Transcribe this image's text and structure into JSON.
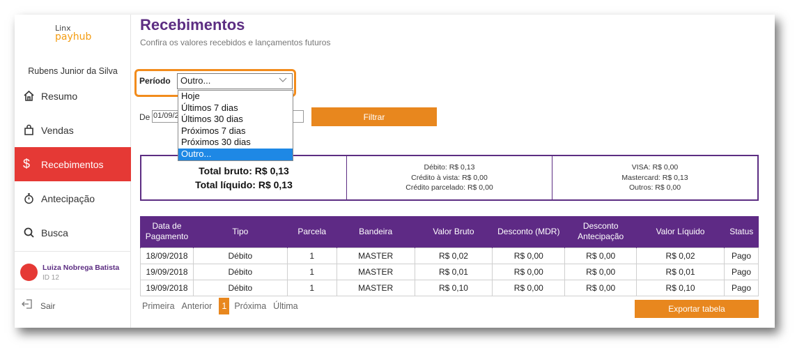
{
  "brand": {
    "line1": "Linx",
    "line2": "payhub"
  },
  "merchant_name": "Rubens Junior da Silva",
  "nav": [
    {
      "label": "Resumo",
      "icon": "home-icon"
    },
    {
      "label": "Vendas",
      "icon": "shopping-bag-icon"
    },
    {
      "label": "Recebimentos",
      "icon": "dollar-icon"
    },
    {
      "label": "Antecipação",
      "icon": "stopwatch-icon"
    },
    {
      "label": "Busca",
      "icon": "search-icon"
    }
  ],
  "user": {
    "name": "Luiza Nobrega Batista",
    "id": "ID 12"
  },
  "logout_label": "Sair",
  "page": {
    "title": "Recebimentos",
    "subtitle": "Confira os valores recebidos e lançamentos futuros"
  },
  "filter": {
    "periodo_label": "Período",
    "selected": "Outro...",
    "options": [
      "Hoje",
      "Últimos 7 dias",
      "Últimos 30 dias",
      "Próximos 7 dias",
      "Próximos 30 dias",
      "Outro..."
    ],
    "de_label": "De",
    "date_from": "01/09/2",
    "button": "Filtrar"
  },
  "summary": {
    "total_bruto": "Total bruto: R$ 0,13",
    "total_liquido": "Total líquido: R$ 0,13",
    "debito": "Débito: R$ 0,13",
    "credito_vista": "Crédito à vista: R$ 0,00",
    "credito_parcelado": "Crédito parcelado: R$ 0,00",
    "visa": "VISA: R$ 0,00",
    "mastercard": "Mastercard: R$ 0,13",
    "outros": "Outros: R$ 0,00"
  },
  "table": {
    "headers": [
      "Data de Pagamento",
      "Tipo",
      "Parcela",
      "Bandeira",
      "Valor Bruto",
      "Desconto (MDR)",
      "Desconto Antecipação",
      "Valor Líquido",
      "Status"
    ],
    "rows": [
      [
        "18/09/2018",
        "Débito",
        "1",
        "MASTER",
        "R$ 0,02",
        "R$ 0,00",
        "R$ 0,00",
        "R$ 0,02",
        "Pago"
      ],
      [
        "19/09/2018",
        "Débito",
        "1",
        "MASTER",
        "R$ 0,01",
        "R$ 0,00",
        "R$ 0,00",
        "R$ 0,01",
        "Pago"
      ],
      [
        "19/09/2018",
        "Débito",
        "1",
        "MASTER",
        "R$ 0,10",
        "R$ 0,00",
        "R$ 0,00",
        "R$ 0,10",
        "Pago"
      ]
    ]
  },
  "pager": {
    "first": "Primeira",
    "prev": "Anterior",
    "current": "1",
    "next": "Próxima",
    "last": "Última"
  },
  "export_button": "Exportar tabela",
  "colors": {
    "accent": "#e8871e",
    "brand_purple": "#5c2d82",
    "active_red": "#e53935",
    "focus_orange": "#f28c1c"
  }
}
